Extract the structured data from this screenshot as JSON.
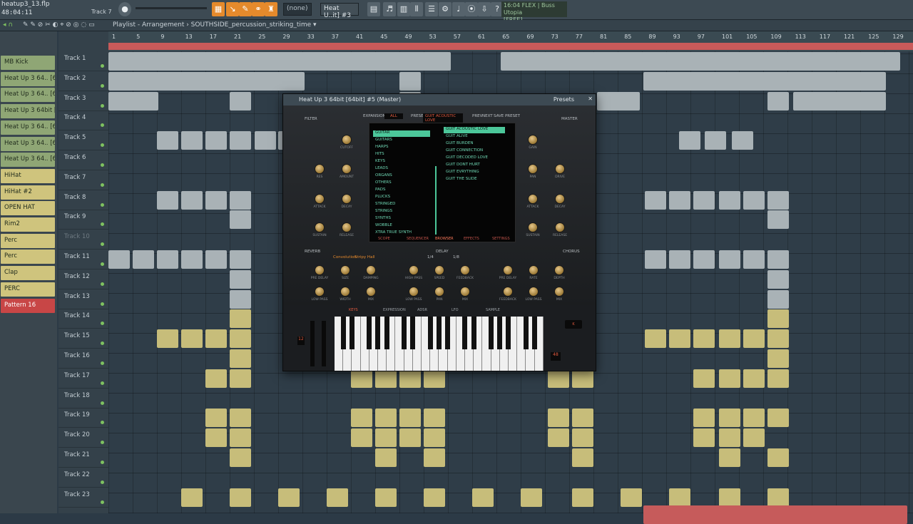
{
  "window": {
    "file": "heatup3_13.flp",
    "time": "48:04:11",
    "track_label": "Track 7",
    "pattern": "(none)",
    "plugin_field": "Heat U..it] #3",
    "hint_line1": "16:04  FLEX | Buss Utopia",
    "hint_line2": "[FREE]"
  },
  "playlist": {
    "title": "Playlist - Arrangement › SOUTHSIDE_percussion_striking_time ▾"
  },
  "channels": [
    {
      "label": "MB Kick",
      "color": "gr"
    },
    {
      "label": "Heat Up 3 64.. [64bit] #2",
      "color": "gr"
    },
    {
      "label": "Heat Up 3 64.. [64bit] #5",
      "color": "gr"
    },
    {
      "label": "Heat Up 3 64bit [64bit]",
      "color": "gr"
    },
    {
      "label": "Heat Up 3 64.. [64bit] #4",
      "color": "gr"
    },
    {
      "label": "Heat Up 3 64.. [64bit] #3",
      "color": "gr"
    },
    {
      "label": "Heat Up 3 64.. [64bit] #6",
      "color": "gr"
    },
    {
      "label": "HiHat",
      "color": "ye"
    },
    {
      "label": "HiHat #2",
      "color": "ye"
    },
    {
      "label": "OPEN HAT",
      "color": "ye"
    },
    {
      "label": "Rim2",
      "color": "ye"
    },
    {
      "label": "Perc",
      "color": "ye"
    },
    {
      "label": "Perc",
      "color": "ye"
    },
    {
      "label": "Clap",
      "color": "ye"
    },
    {
      "label": "PERC",
      "color": "ye"
    },
    {
      "label": "Pattern 16",
      "color": "rd"
    }
  ],
  "tracks": [
    "Track 1",
    "Track 2",
    "Track 3",
    "Track 4",
    "Track 5",
    "Track 6",
    "Track 7",
    "Track 8",
    "Track 9",
    "Track 10",
    "Track 11",
    "Track 12",
    "Track 13",
    "Track 14",
    "Track 15",
    "Track 16",
    "Track 17",
    "Track 18",
    "Track 19",
    "Track 20",
    "Track 21",
    "Track 22",
    "Track 23"
  ],
  "ruler": [
    "1",
    "5",
    "9",
    "13",
    "17",
    "21",
    "25",
    "29",
    "33",
    "37",
    "41",
    "45",
    "49",
    "53",
    "57",
    "61",
    "65",
    "69",
    "73",
    "77",
    "81",
    "85",
    "89",
    "93",
    "97",
    "101",
    "105",
    "109",
    "113",
    "117",
    "121",
    "125",
    "129"
  ],
  "plugin": {
    "title": "Heat Up 3 64bit [64bit] #5 (Master)",
    "presets_label": "Presets",
    "expansion_label": "EXPANSION",
    "expansion_value": "ALL",
    "preset_label": "PRESET",
    "preset_value": "GUIT ACOUSTIC LOVE",
    "prev": "PREV",
    "next": "NEXT",
    "save": "SAVE PRESET",
    "filter": "FILTER",
    "master": "MASTER",
    "reverb": "REVERB",
    "delay": "DELAY",
    "chorus": "CHORUS",
    "categories": [
      "GUITAR",
      "GUITARS",
      "HARPS",
      "HITS",
      "KEYS",
      "LEADS",
      "ORGANS",
      "OTHERS",
      "PADS",
      "PLUCKS",
      "STRINGED",
      "STRINGS",
      "SYNTHS",
      "WOBBLE",
      "XTRA TRUE SYNTH"
    ],
    "presets": [
      "GUIT ACOUSTIC LOVE",
      "GUIT ALIVE",
      "GUIT BURDEN",
      "GUIT CONNECTION",
      "GUIT DECODED LOVE",
      "GUIT DONT HURT",
      "GUIT EVRYTHING",
      "GUIT THE SLIDE"
    ],
    "browser_tabs": [
      "SCOPE",
      "SEQUENCER",
      "BROWSER",
      "EFFECTS",
      "SETTINGS"
    ],
    "filter_knobs": [
      "CUTOFF",
      "RES",
      "AMOUNT",
      "ATTACK",
      "DECAY",
      "SUSTAIN",
      "RELEASE"
    ],
    "master_knobs": [
      "GAIN",
      "PAN",
      "DRIVE",
      "ATTACK",
      "DECAY",
      "SUSTAIN",
      "RELEASE"
    ],
    "reverb_type": "Convolution",
    "reverb_preset": "Stripy Hall",
    "reverb_knobs": [
      "PRE DELAY",
      "SIZE",
      "DAMPING",
      "LOW PASS",
      "WIDTH",
      "MIX"
    ],
    "delay_values": [
      "1/4",
      "1/8"
    ],
    "delay_knobs": [
      "HIGH PASS",
      "SPEED",
      "FEEDBACK",
      "LOW PASS",
      "PAN",
      "MIX"
    ],
    "chorus_knobs": [
      "PRE DELAY",
      "RATE",
      "DEPTH",
      "FEEDBACK",
      "LOW PASS",
      "MIX"
    ],
    "bottom_tabs": [
      "KEYS",
      "EXPRESSION",
      "ADSR",
      "LFO",
      "SAMPLE"
    ],
    "pitch_value": "12",
    "voices_value": "48"
  }
}
